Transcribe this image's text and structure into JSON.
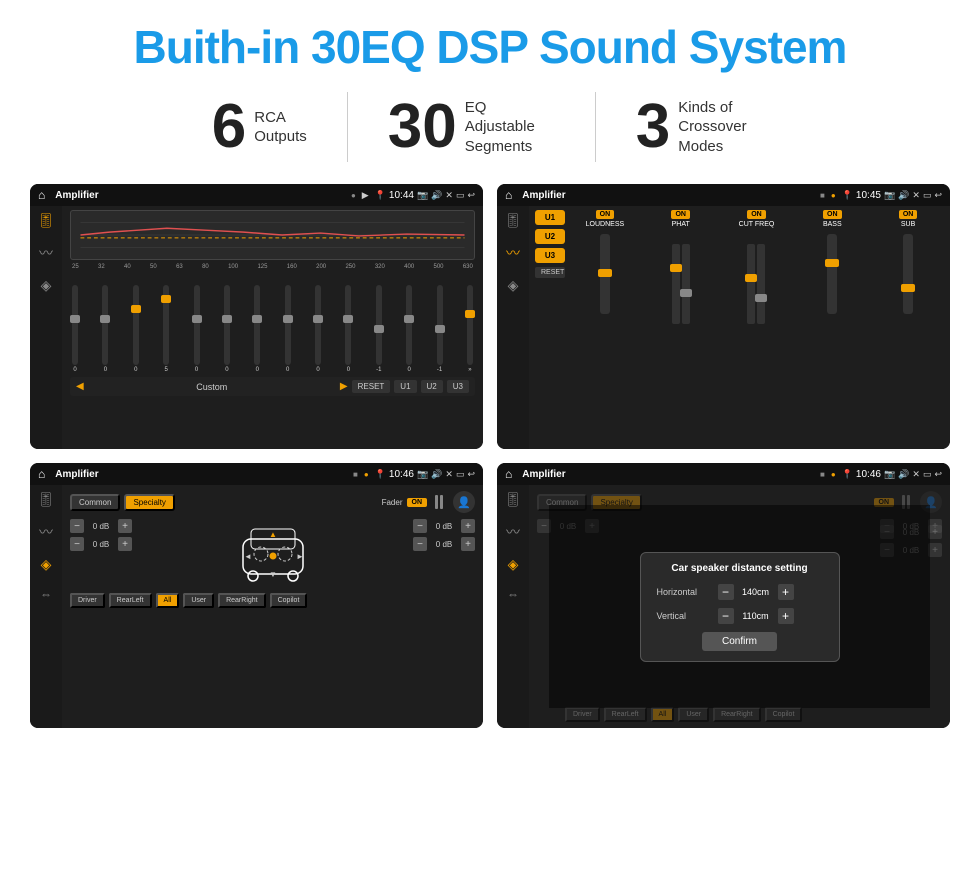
{
  "header": {
    "title": "Buith-in 30EQ DSP Sound System"
  },
  "stats": [
    {
      "number": "6",
      "label": "RCA\nOutputs"
    },
    {
      "number": "30",
      "label": "EQ Adjustable\nSegments"
    },
    {
      "number": "3",
      "label": "Kinds of\nCrossover Modes"
    }
  ],
  "screens": {
    "eq": {
      "title": "Amplifier",
      "time": "10:44",
      "frequencies": [
        "25",
        "32",
        "40",
        "50",
        "63",
        "80",
        "100",
        "125",
        "160",
        "200",
        "250",
        "320",
        "400",
        "500",
        "630"
      ],
      "values": [
        "0",
        "0",
        "0",
        "5",
        "0",
        "0",
        "0",
        "0",
        "0",
        "0",
        "-1",
        "0",
        "-1"
      ],
      "controls": [
        "Custom",
        "RESET",
        "U1",
        "U2",
        "U3"
      ]
    },
    "crossover": {
      "title": "Amplifier",
      "time": "10:45",
      "uButtons": [
        "U1",
        "U2",
        "U3"
      ],
      "cols": [
        "LOUDNESS",
        "PHAT",
        "CUT FREQ",
        "BASS",
        "SUB"
      ],
      "resetLabel": "RESET"
    },
    "fader": {
      "title": "Amplifier",
      "time": "10:46",
      "tabs": [
        "Common",
        "Specialty"
      ],
      "faderLabel": "Fader",
      "onLabel": "ON",
      "dbValues": [
        "0 dB",
        "0 dB",
        "0 dB",
        "0 dB"
      ],
      "bottomBtns": [
        "Driver",
        "RearLeft",
        "All",
        "User",
        "RearRight",
        "Copilot"
      ]
    },
    "dialog": {
      "title": "Amplifier",
      "time": "10:46",
      "tabs": [
        "Common",
        "Specialty"
      ],
      "onLabel": "ON",
      "dialogTitle": "Car speaker distance setting",
      "horizontalLabel": "Horizontal",
      "horizontalValue": "140cm",
      "verticalLabel": "Vertical",
      "verticalValue": "110cm",
      "confirmLabel": "Confirm",
      "dbValues": [
        "0 dB",
        "0 dB"
      ],
      "btns": [
        "Driver",
        "RearLeft",
        "All",
        "User",
        "RearRight",
        "Copilot"
      ]
    }
  },
  "icons": {
    "home": "⌂",
    "back": "↩",
    "location": "📍",
    "camera": "📷",
    "volume": "🔊",
    "close": "✕",
    "rect": "▭",
    "equalizer": "≡",
    "wave": "~",
    "speaker": "◈",
    "settings": "⚙",
    "chevronLeft": "◀",
    "chevronRight": "▶",
    "chevronDown": "▼",
    "dots": "•••",
    "person": "👤"
  },
  "colors": {
    "accent": "#f0a000",
    "blue": "#1a9be8",
    "dark": "#1a1a1a",
    "panel": "#1e1e1e",
    "text": "#ffffff"
  }
}
